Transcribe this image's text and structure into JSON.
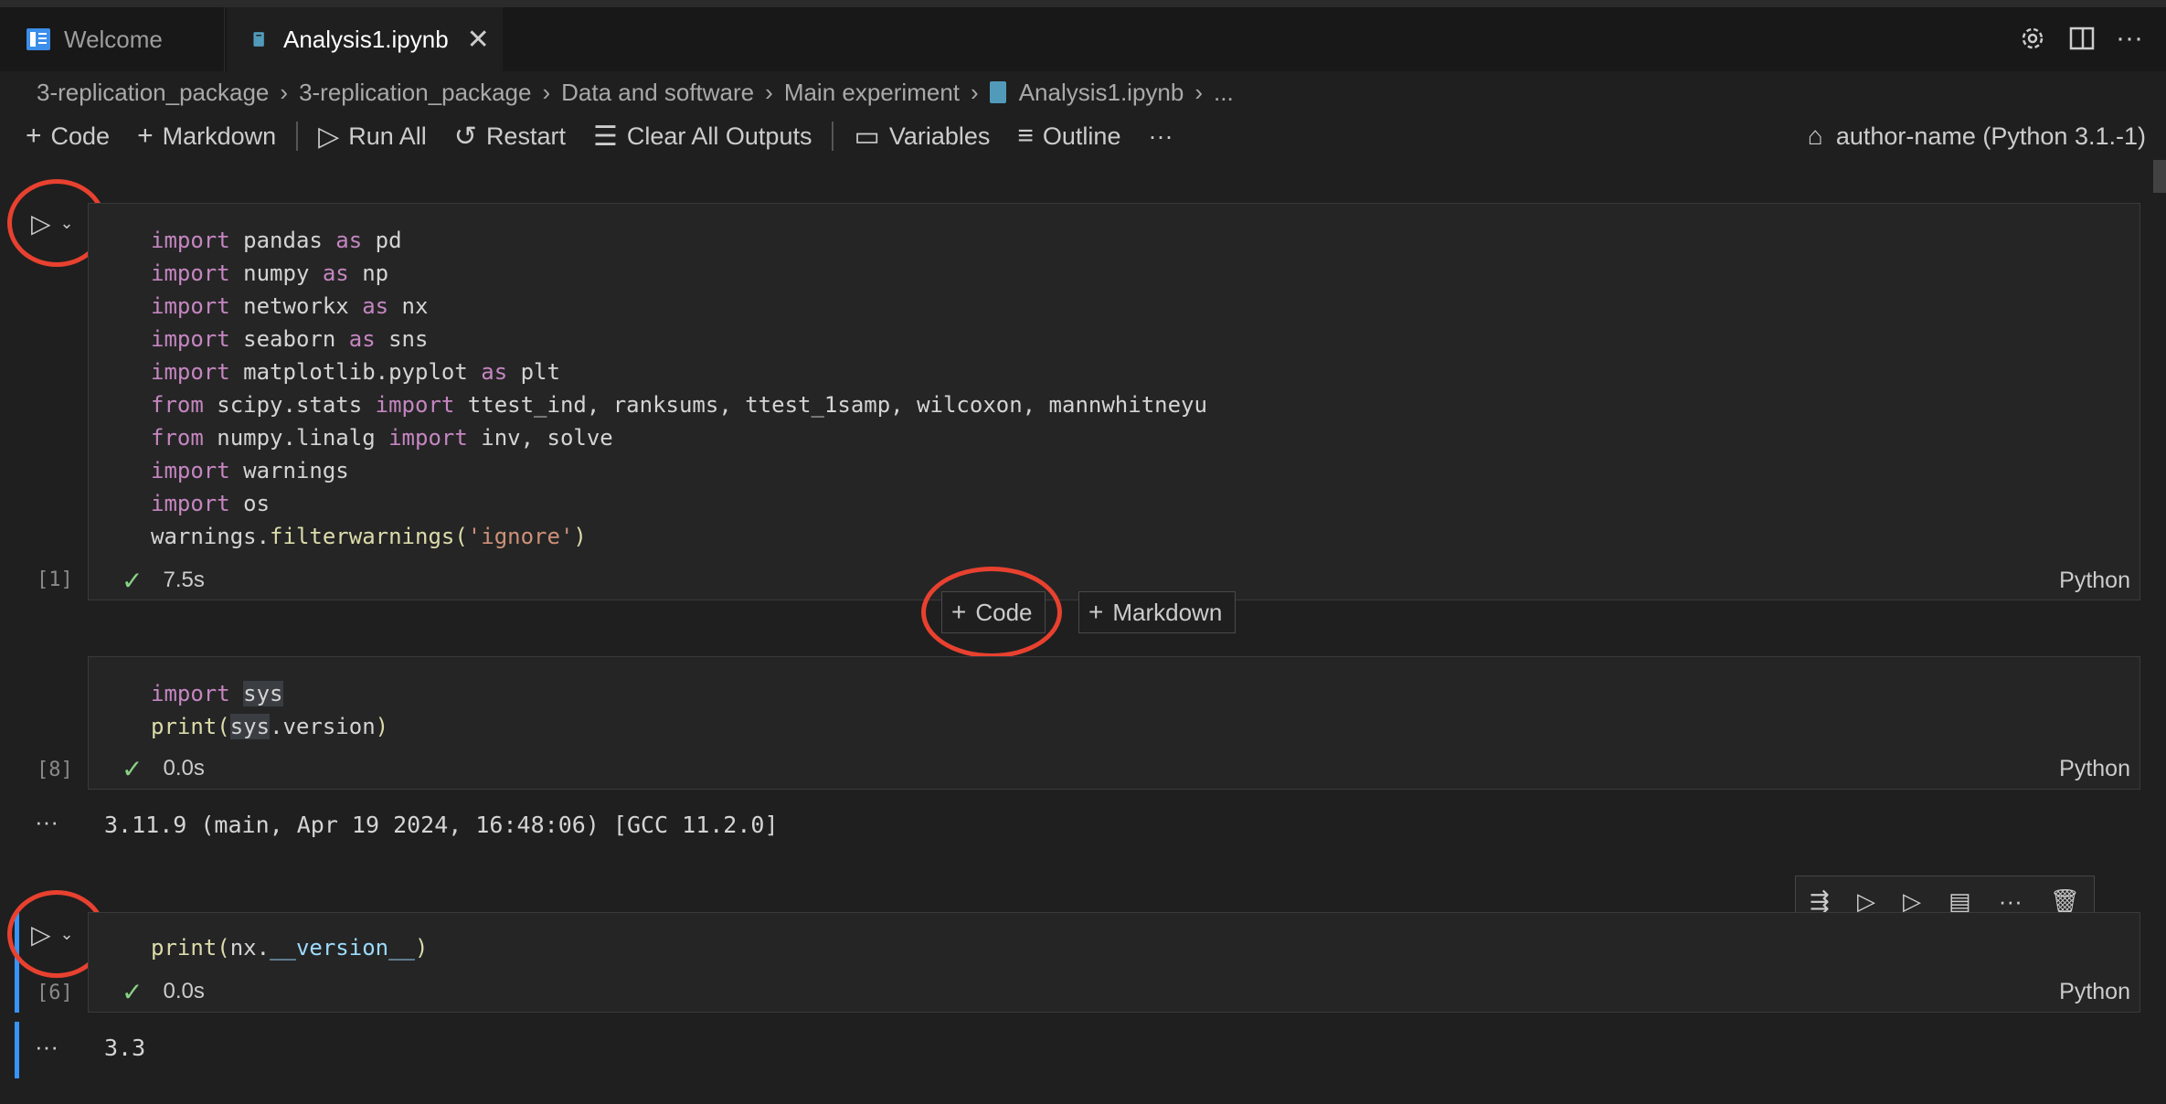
{
  "tabs": [
    {
      "label": "Welcome",
      "active": false
    },
    {
      "label": "Analysis1.ipynb",
      "active": true
    }
  ],
  "breadcrumb": [
    "3-replication_package",
    "3-replication_package",
    "Data and software",
    "Main experiment",
    "Analysis1.ipynb",
    "..."
  ],
  "toolbar": {
    "code": "Code",
    "markdown": "Markdown",
    "run_all": "Run All",
    "restart": "Restart",
    "clear_outputs": "Clear All Outputs",
    "variables": "Variables",
    "outline": "Outline",
    "more": "···"
  },
  "kernel": {
    "label": "author-name (Python 3.1.-1)"
  },
  "cells": [
    {
      "exec_count": "[1]",
      "duration": "7.5s",
      "language": "Python"
    },
    {
      "exec_count": "[8]",
      "duration": "0.0s",
      "language": "Python",
      "output": "3.11.9 (main, Apr 19 2024, 16:48:06) [GCC 11.2.0]"
    },
    {
      "exec_count": "[6]",
      "duration": "0.0s",
      "language": "Python",
      "output": "3.3"
    }
  ],
  "insert_buttons": {
    "code": "Code",
    "markdown": "Markdown"
  },
  "output_dots": "···",
  "icons": {
    "accent_marker": "#e8412f",
    "success": "#89d185",
    "focus_bar": "#3794ff"
  }
}
